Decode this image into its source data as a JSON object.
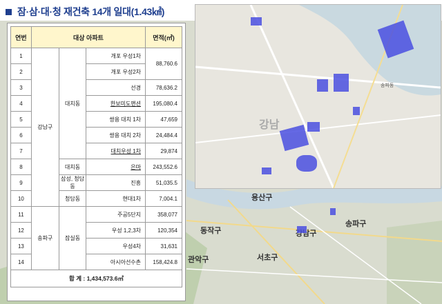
{
  "title": "잠·삼·대·청 재건축 14개 일대(1.43㎢)",
  "table": {
    "headers": [
      "연번",
      "대상 아파트",
      "면적(㎡)"
    ],
    "rows": [
      {
        "no": "1",
        "gu": "강남구",
        "dong": "대치동",
        "apt": "개포 우성1차",
        "area": "88,760.6"
      },
      {
        "no": "2",
        "apt": "개포 우성2차"
      },
      {
        "no": "3",
        "apt": "선경",
        "area": "78,636.2"
      },
      {
        "no": "4",
        "apt": "한보미도맨션",
        "area": "195,080.4"
      },
      {
        "no": "5",
        "apt": "쌍용 대치 1차",
        "area": "47,659"
      },
      {
        "no": "6",
        "apt": "쌍용 대치 2차",
        "area": "24,484.4"
      },
      {
        "no": "7",
        "apt": "대치우성 1차",
        "area": "29,874"
      },
      {
        "no": "8",
        "dong": "대치동",
        "apt": "은마",
        "area": "243,552.6"
      },
      {
        "no": "9",
        "dong": "삼성, 청담동",
        "apt": "진흥",
        "area": "51,035.5"
      },
      {
        "no": "10",
        "dong": "청담동",
        "apt": "현대1차",
        "area": "7,004.1"
      },
      {
        "no": "11",
        "gu": "송파구",
        "dong": "잠실동",
        "apt": "주공5단지",
        "area": "358,077"
      },
      {
        "no": "12",
        "apt": "우성 1,2,3차",
        "area": "120,354"
      },
      {
        "no": "13",
        "apt": "우성4차",
        "area": "31,631"
      },
      {
        "no": "14",
        "apt": "아시아선수촌",
        "area": "158,424.8"
      }
    ],
    "total": "합    계 : 1,434,573.6㎡"
  },
  "map_labels": {
    "yongsan": "용산구",
    "dongjak": "동작구",
    "seocho": "서초구",
    "gangnam": "강남구",
    "songpa": "송파구",
    "gwanak": "관악구",
    "gangnam_inset": "강남",
    "inset_songpa": "송파동"
  }
}
